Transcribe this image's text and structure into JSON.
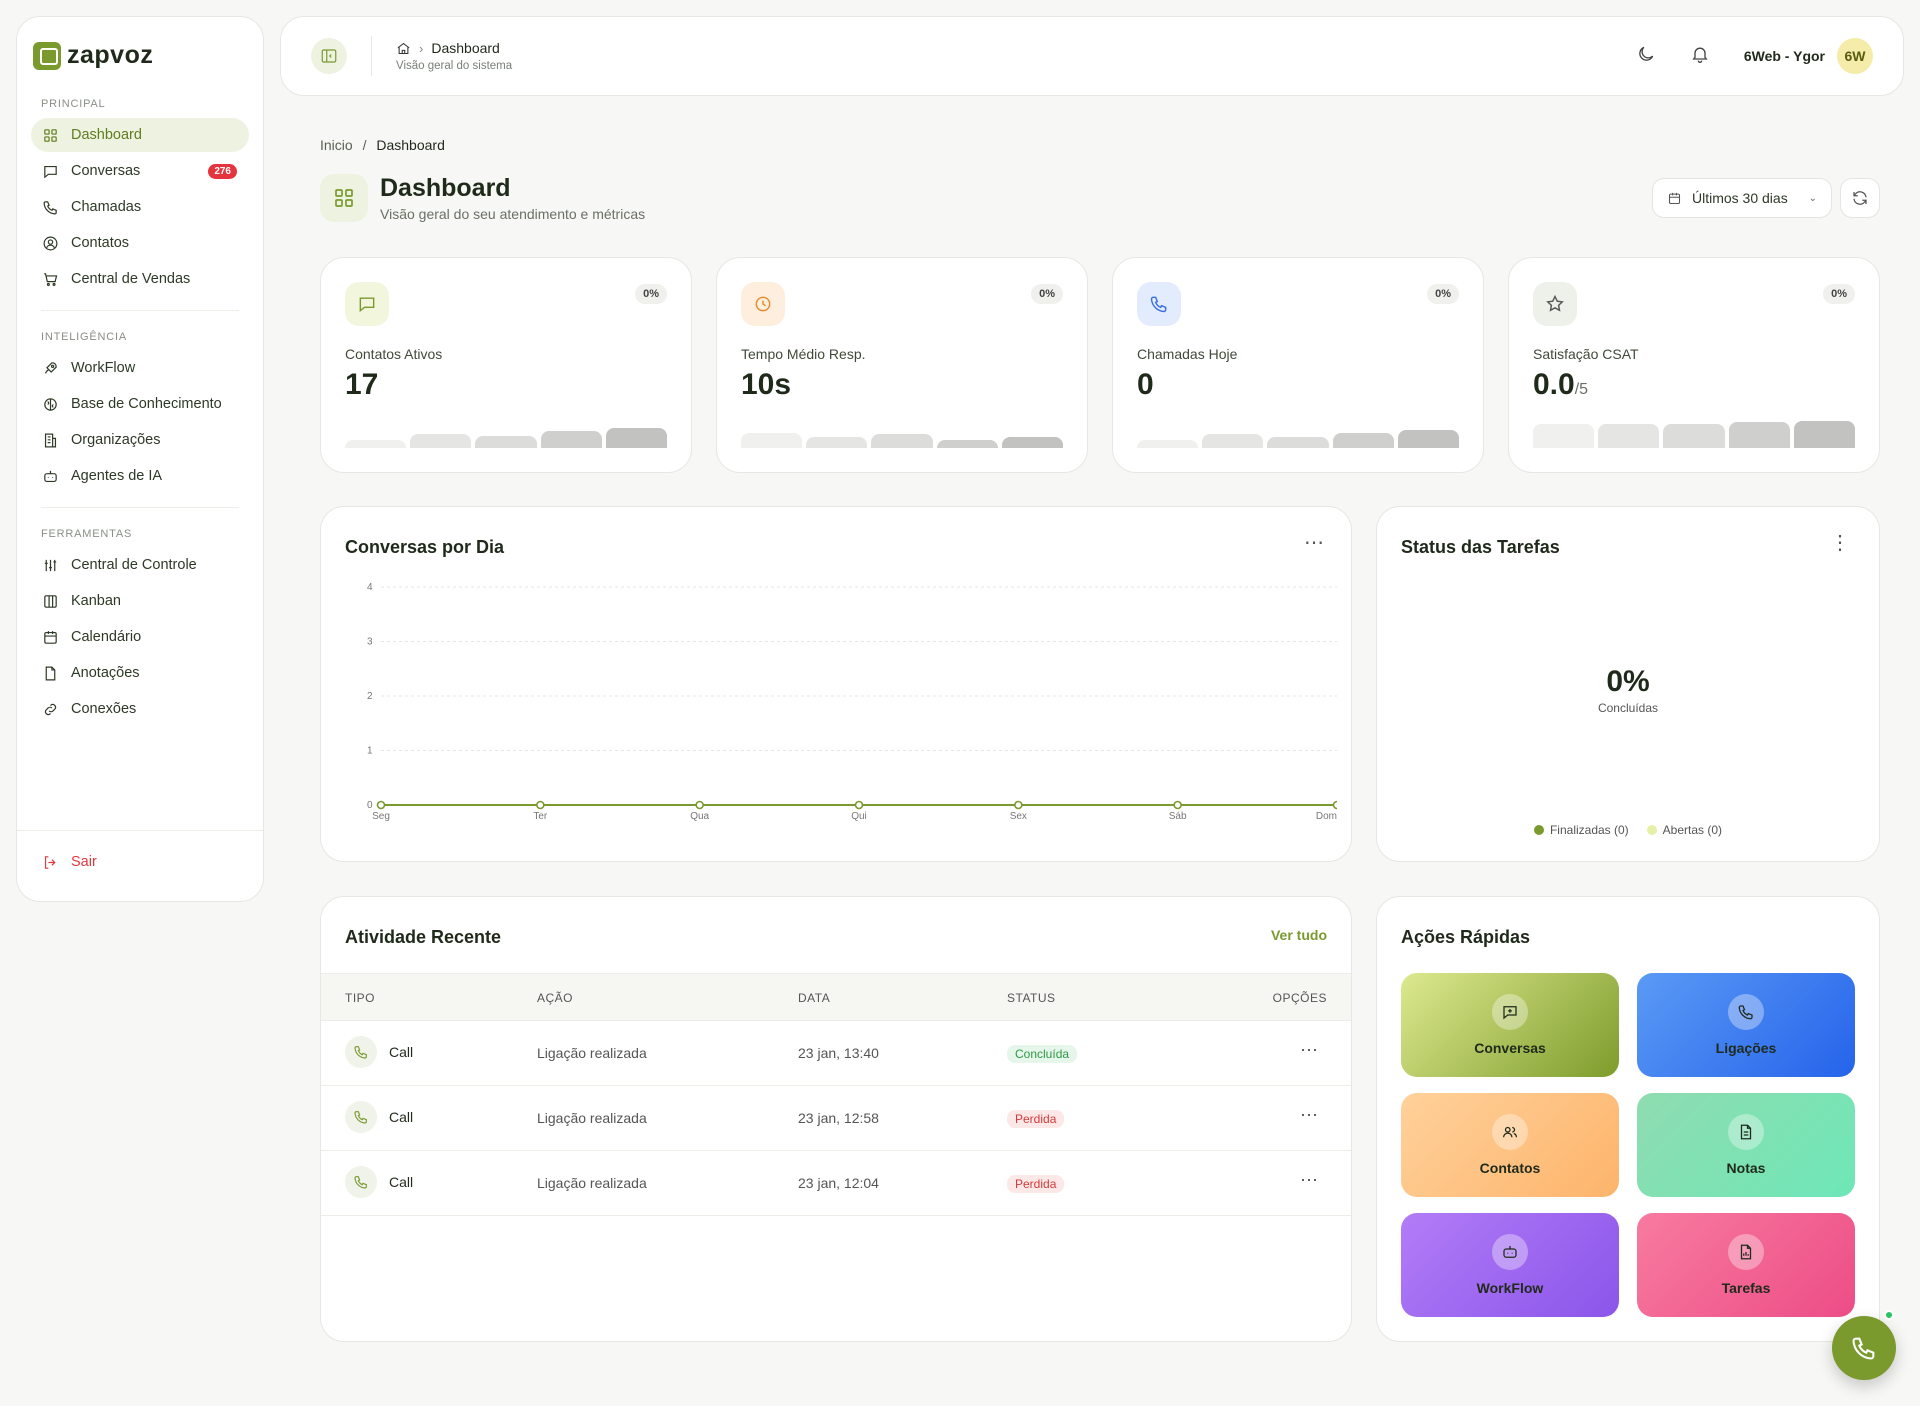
{
  "app": {
    "logo_text": "zapvoz"
  },
  "sidebar": {
    "sections": [
      {
        "title": "PRINCIPAL",
        "items": [
          {
            "label": "Dashboard",
            "icon": "grid-icon",
            "active": true
          },
          {
            "label": "Conversas",
            "icon": "chat-icon",
            "badge": "276"
          },
          {
            "label": "Chamadas",
            "icon": "phone-icon"
          },
          {
            "label": "Contatos",
            "icon": "user-circle-icon"
          },
          {
            "label": "Central de Vendas",
            "icon": "cart-icon"
          }
        ]
      },
      {
        "title": "INTELIGÊNCIA",
        "items": [
          {
            "label": "WorkFlow",
            "icon": "rocket-icon"
          },
          {
            "label": "Base de Conhecimento",
            "icon": "brain-icon"
          },
          {
            "label": "Organizações",
            "icon": "building-icon"
          },
          {
            "label": "Agentes de IA",
            "icon": "bot-icon"
          }
        ]
      },
      {
        "title": "FERRAMENTAS",
        "items": [
          {
            "label": "Central de Controle",
            "icon": "sliders-icon"
          },
          {
            "label": "Kanban",
            "icon": "kanban-icon"
          },
          {
            "label": "Calendário",
            "icon": "calendar-icon"
          },
          {
            "label": "Anotações",
            "icon": "file-icon"
          },
          {
            "label": "Conexões",
            "icon": "link-icon"
          }
        ]
      }
    ],
    "logout_label": "Sair"
  },
  "header": {
    "crumb_title": "Dashboard",
    "crumb_sub": "Visão geral do sistema",
    "user_name": "6Web - Ygor",
    "avatar": "6W"
  },
  "page": {
    "breadcrumb_home": "Inicio",
    "breadcrumb_sep": "/",
    "breadcrumb_current": "Dashboard",
    "title": "Dashboard",
    "subtitle": "Visão geral do seu atendimento e métricas",
    "period": "Últimos 30 dias"
  },
  "stats": [
    {
      "label": "Contatos Ativos",
      "value": "17",
      "suffix": "",
      "pct": "0%",
      "icon": "chat-icon",
      "icon_bg": "#f1f6dc",
      "icon_color": "#7a9a2e",
      "spark": [
        0.25,
        0.45,
        0.4,
        0.55,
        0.65
      ]
    },
    {
      "label": "Tempo Médio Resp.",
      "value": "10s",
      "suffix": "",
      "pct": "0%",
      "icon": "clock-icon",
      "icon_bg": "#fdeedd",
      "icon_color": "#e8892a",
      "spark": [
        0.5,
        0.35,
        0.45,
        0.25,
        0.35
      ]
    },
    {
      "label": "Chamadas Hoje",
      "value": "0",
      "suffix": "",
      "pct": "0%",
      "icon": "phone-icon",
      "icon_bg": "#e3ecfc",
      "icon_color": "#3b6fe0",
      "spark": [
        0.25,
        0.45,
        0.35,
        0.5,
        0.6
      ]
    },
    {
      "label": "Satisfação CSAT",
      "value": "0.0",
      "suffix": "/5",
      "pct": "0%",
      "icon": "star-icon",
      "icon_bg": "#eef0ea",
      "icon_color": "#555555",
      "spark": [
        0.8,
        0.8,
        0.8,
        0.85,
        0.9
      ]
    }
  ],
  "conversations_chart": {
    "title": "Conversas por Dia",
    "chart_data": {
      "type": "line",
      "categories": [
        "Seg",
        "Ter",
        "Qua",
        "Qui",
        "Sex",
        "Sáb",
        "Dom"
      ],
      "values": [
        0,
        0,
        0,
        0,
        0,
        0,
        0
      ],
      "ylim": [
        0,
        4
      ],
      "yticks": [
        0,
        1,
        2,
        3,
        4
      ],
      "color": "#7a9a2e",
      "grid": true
    }
  },
  "tasks": {
    "title": "Status das Tarefas",
    "percent": "0%",
    "percent_label": "Concluídas",
    "legend": [
      {
        "label": "Finalizadas (0)",
        "color": "#7a9a2e"
      },
      {
        "label": "Abertas (0)",
        "color": "#e6f0a6"
      }
    ]
  },
  "activity": {
    "title": "Atividade Recente",
    "see_all": "Ver tudo",
    "columns": [
      "TIPO",
      "AÇÃO",
      "DATA",
      "STATUS",
      "OPÇÕES"
    ],
    "rows": [
      {
        "type": "Call",
        "action": "Ligação realizada",
        "date": "23 jan, 13:40",
        "status": "Concluída",
        "status_kind": "ok"
      },
      {
        "type": "Call",
        "action": "Ligação realizada",
        "date": "23 jan, 12:58",
        "status": "Perdida",
        "status_kind": "lost"
      },
      {
        "type": "Call",
        "action": "Ligação realizada",
        "date": "23 jan, 12:04",
        "status": "Perdida",
        "status_kind": "lost"
      }
    ]
  },
  "quick_actions": {
    "title": "Ações Rápidas",
    "items": [
      {
        "label": "Conversas",
        "icon": "chat-plus-icon",
        "gradient": [
          "#dde98f",
          "#7e9c2c"
        ]
      },
      {
        "label": "Ligações",
        "icon": "phone-icon",
        "gradient": [
          "#5b9af5",
          "#2563eb"
        ]
      },
      {
        "label": "Contatos",
        "icon": "users-icon",
        "gradient": [
          "#ffd19b",
          "#fdb46b"
        ]
      },
      {
        "label": "Notas",
        "icon": "file-text-icon",
        "gradient": [
          "#8fdcb0",
          "#6ee7b7"
        ]
      },
      {
        "label": "WorkFlow",
        "icon": "bot-icon",
        "gradient": [
          "#b27cf7",
          "#8b55ea"
        ]
      },
      {
        "label": "Tarefas",
        "icon": "file-chart-icon",
        "gradient": [
          "#f87ba0",
          "#ec4d86"
        ]
      }
    ]
  }
}
